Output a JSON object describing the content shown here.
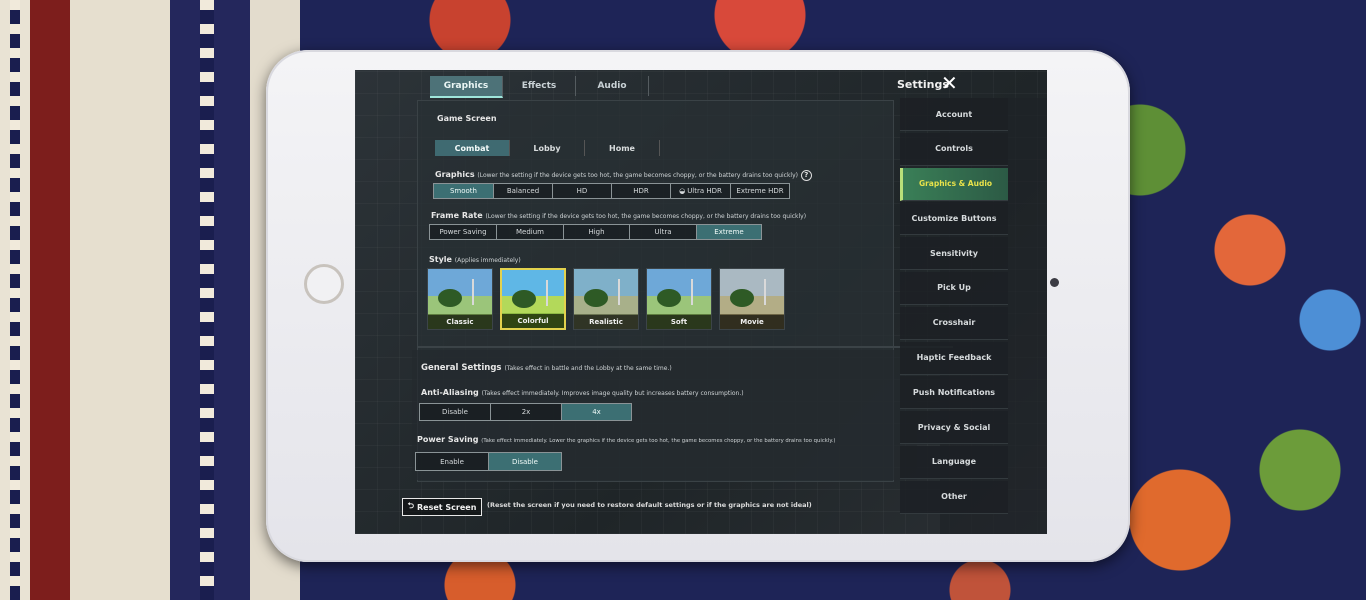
{
  "top_tabs": [
    "Graphics",
    "Effects",
    "Audio"
  ],
  "header": {
    "title": "Settings",
    "close_glyph": "✕"
  },
  "game_screen": {
    "title": "Game Screen",
    "tabs": [
      "Combat",
      "Lobby",
      "Home"
    ],
    "active_tab": "Combat"
  },
  "graphics": {
    "label": "Graphics",
    "note": "(Lower the setting if the device gets too hot, the game becomes choppy, or the battery drains too quickly)",
    "help_glyph": "?",
    "options": [
      "Smooth",
      "Balanced",
      "HD",
      "HDR",
      "Ultra HDR",
      "Extreme HDR"
    ],
    "selected": "Smooth"
  },
  "frame_rate": {
    "label": "Frame Rate",
    "note": "(Lower the setting if the device gets too hot, the game becomes choppy, or the battery drains too quickly)",
    "options": [
      "Power Saving",
      "Medium",
      "High",
      "Ultra",
      "Extreme"
    ],
    "selected": "Extreme"
  },
  "style": {
    "label": "Style",
    "note": "(Applies immediately)",
    "options": [
      "Classic",
      "Colorful",
      "Realistic",
      "Soft",
      "Movie"
    ],
    "selected": "Colorful"
  },
  "general": {
    "title": "General Settings",
    "note": "(Takes effect in battle and the Lobby at the same time.)"
  },
  "anti_aliasing": {
    "label": "Anti-Aliasing",
    "note": "(Takes effect immediately. Improves image quality but increases battery consumption.)",
    "options": [
      "Disable",
      "2x",
      "4x"
    ],
    "selected": "4x"
  },
  "power_saving": {
    "label": "Power Saving",
    "note": "(Take effect immediately. Lower the graphics if the device gets too hot, the game becomes choppy, or the battery drains too quickly.)",
    "options": [
      "Enable",
      "Disable"
    ],
    "selected": "Disable"
  },
  "reset": {
    "label": "Reset Screen",
    "glyph": "⮌",
    "note": "(Reset the screen if you need to restore default settings or if the graphics are not ideal)"
  },
  "sidebar": {
    "items": [
      "Account",
      "Controls",
      "Graphics & Audio",
      "Customize Buttons",
      "Sensitivity",
      "Pick Up",
      "Crosshair",
      "Haptic Feedback",
      "Push Notifications",
      "Privacy & Social",
      "Language",
      "Other"
    ],
    "active": "Graphics & Audio"
  }
}
